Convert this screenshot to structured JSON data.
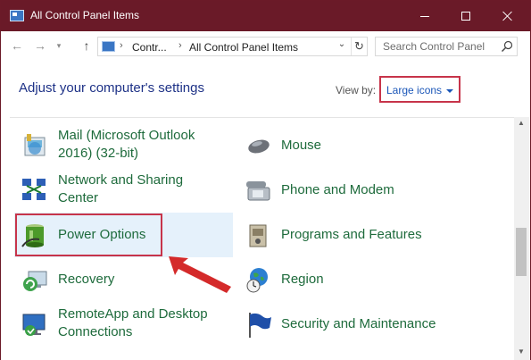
{
  "window": {
    "title": "All Control Panel Items"
  },
  "navigation": {
    "breadcrumb": [
      "Contr...",
      "All Control Panel Items"
    ],
    "search_placeholder": "Search Control Panel"
  },
  "content": {
    "heading": "Adjust your computer's settings",
    "view_by_label": "View by:",
    "view_by_value": "Large icons"
  },
  "items_left": [
    {
      "label_line1": "Mail (Microsoft Outlook",
      "label_line2": "2016) (32-bit)",
      "icon": "mail-icon"
    },
    {
      "label_line1": "Network and Sharing",
      "label_line2": "Center",
      "icon": "network-icon"
    },
    {
      "label": "Power Options",
      "icon": "power-options-icon",
      "selected": true
    },
    {
      "label": "Recovery",
      "icon": "recovery-icon"
    },
    {
      "label_line1": "RemoteApp and Desktop",
      "label_line2": "Connections",
      "icon": "remote-desktop-icon"
    }
  ],
  "items_right": [
    {
      "label": "Mouse",
      "icon": "mouse-icon"
    },
    {
      "label": "Phone and Modem",
      "icon": "phone-modem-icon"
    },
    {
      "label": "Programs and Features",
      "icon": "programs-icon"
    },
    {
      "label": "Region",
      "icon": "region-icon"
    },
    {
      "label": "Security and Maintenance",
      "icon": "security-flag-icon"
    }
  ],
  "colors": {
    "titlebar": "#6a1a28",
    "link_green": "#1e6b3c",
    "heading_blue": "#1e3287",
    "annotation_red": "#c7344a",
    "selection": "#e5f1fb"
  }
}
